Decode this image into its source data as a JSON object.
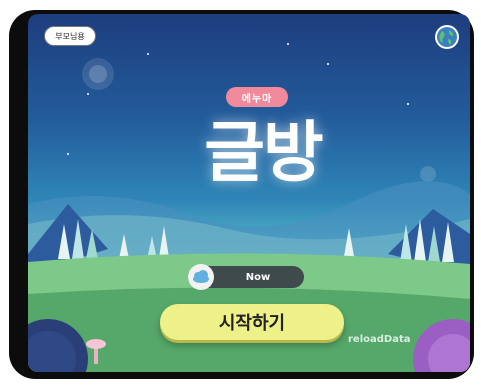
{
  "header": {
    "parent_button": "부모님용",
    "language_icon": "globe-icon"
  },
  "logo": {
    "badge": "에누마",
    "title": "글방"
  },
  "now_toggle": {
    "label": "Now",
    "knob_icon": "cloud-icon"
  },
  "start_button": {
    "label": "시작하기"
  },
  "debug": {
    "reload_label": "reloadData"
  },
  "colors": {
    "start_button": "#eef08a",
    "toggle_bg": "#3f4a4d",
    "badge": "#f08a9a"
  }
}
